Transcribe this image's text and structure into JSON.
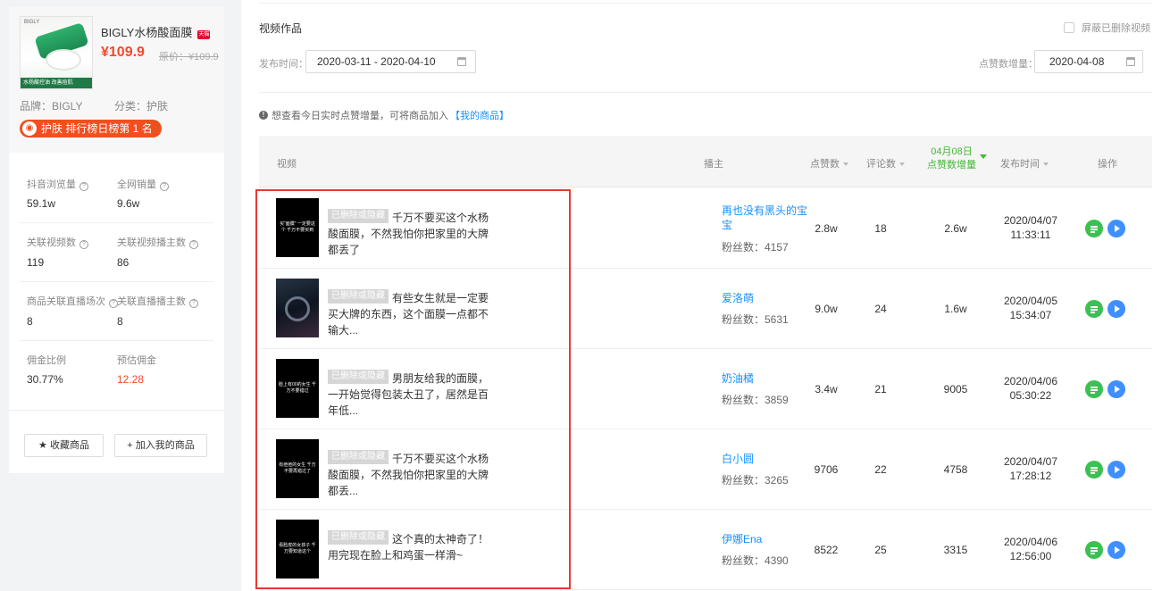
{
  "product": {
    "thumb_brand": "BIGLY",
    "thumb_caption": "水杨酸控油 改善痘肌",
    "name": "BIGLY水杨酸面膜",
    "price": "¥109.9",
    "orig_price": "原价：¥109.9",
    "brand": "品牌：BIGLY",
    "category": "分类：护肤",
    "rank_badge": "护肤 排行榜日榜第 1 名"
  },
  "stats": [
    {
      "label": "抖音浏览量",
      "value": "59.1w"
    },
    {
      "label": "全网销量",
      "value": "9.6w"
    },
    {
      "label": "关联视频数",
      "value": "119"
    },
    {
      "label": "关联视频播主数",
      "value": "86"
    },
    {
      "label": "商品关联直播场次",
      "value": "8"
    },
    {
      "label": "关联直播播主数",
      "value": "8"
    },
    {
      "label": "佣金比例",
      "value": "30.77%"
    },
    {
      "label": "预估佣金",
      "value": "12.28"
    }
  ],
  "left_buttons": {
    "favorite": "★ 收藏商品",
    "add_mine": "+ 加入我的商品"
  },
  "main": {
    "section_title": "视频作品",
    "hide_deleted": "屏蔽已删除视频",
    "publish_time_label": "发布时间：",
    "date_range": "2020-03-11 - 2020-04-10",
    "likes_inc_label": "点赞数增量：",
    "likes_date": "2020-04-08",
    "tip_text": "想查看今日实时点赞增量，可将商品加入",
    "tip_link": "【我的商品】"
  },
  "table": {
    "headers": {
      "video": "视频",
      "author": "播主",
      "likes": "点赞数",
      "comments": "评论数",
      "inc_date": "04月08日",
      "inc_label": "点赞数增量",
      "publish": "发布时间",
      "ops": "操作"
    },
    "deleted_tag": "已删除或隐藏",
    "rows": [
      {
        "overlay": "买“面膜” 一定要这个 千万不要买到",
        "title": "千万不要买这个水杨酸面膜，不然我怕你把家里的大牌都丢了",
        "author": "再也没有黑头的宝宝",
        "fans": "粉丝数：4157",
        "likes": "2.8w",
        "comments": "18",
        "inc": "2.6w",
        "date": "2020/04/07",
        "time": "11:33:11"
      },
      {
        "overlay": "",
        "title": "有些女生就是一定要买大牌的东西，这个面膜一点都不输大...",
        "author": "爱洛萌",
        "fans": "粉丝数：5631",
        "likes": "9.0w",
        "comments": "24",
        "inc": "1.6w",
        "date": "2020/04/05",
        "time": "15:34:07"
      },
      {
        "overlay": "脸上有00的女生 千万不要错过",
        "title": "男朋友给我的面膜，一开始觉得包装太丑了，居然是百年低...",
        "author": "奶油橘",
        "fans": "粉丝数：3859",
        "likes": "3.4w",
        "comments": "21",
        "inc": "9005",
        "date": "2020/04/06",
        "time": "05:30:22"
      },
      {
        "overlay": "有痘痘的女生 千万不要再错过了",
        "title": "千万不要买这个水杨酸面膜，不然我怕你把家里的大牌都丢...",
        "author": "白小圆",
        "fans": "粉丝数：3265",
        "likes": "9706",
        "comments": "22",
        "inc": "4758",
        "date": "2020/04/07",
        "time": "17:28:12"
      },
      {
        "overlay": "看脸皮的女孩子 千万要知道这个",
        "title": "这个真的太神奇了！用完现在脸上和鸡蛋一样滑~",
        "author": "伊娜Ena",
        "fans": "粉丝数：4390",
        "likes": "8522",
        "comments": "25",
        "inc": "3315",
        "date": "2020/04/06",
        "time": "12:56:00"
      }
    ]
  },
  "colors": {
    "accent_red": "#f5492a",
    "link_blue": "#1890ff",
    "green": "#41b934",
    "highlight_box": "#e53935"
  }
}
